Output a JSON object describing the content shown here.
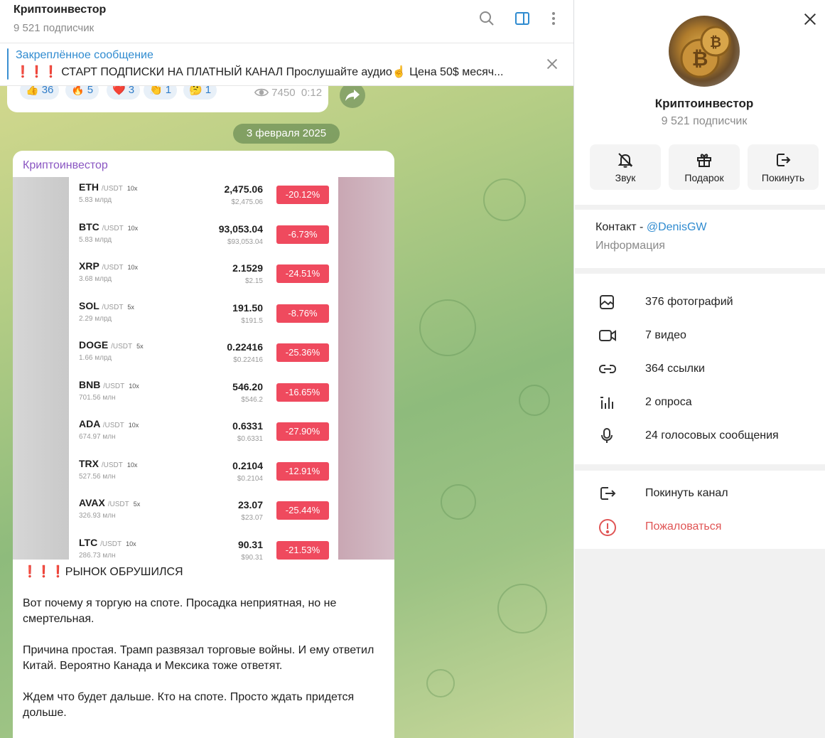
{
  "chat": {
    "title": "Криптоинвестор",
    "subtitle": "9 521 подписчик",
    "icons": [
      "search-icon",
      "panel-toggle-icon",
      "more-vertical-icon"
    ]
  },
  "pinned": {
    "title": "Закреплённое сообщение",
    "text": "❗❗❗ СТАРТ ПОДПИСКИ НА ПЛАТНЫЙ КАНАЛ  Прослушайте аудио☝️  Цена 50$ месяч..."
  },
  "prev_message": {
    "reactions": [
      {
        "emoji": "👍",
        "count": "36"
      },
      {
        "emoji": "🔥",
        "count": "5"
      },
      {
        "emoji": "❤️",
        "count": "3"
      },
      {
        "emoji": "👏",
        "count": "1"
      },
      {
        "emoji": "🤔",
        "count": "1"
      }
    ],
    "views": "7450",
    "duration": "0:12"
  },
  "date_separator": "3 февраля 2025",
  "message": {
    "author": "Криптоинвестор",
    "table": [
      {
        "sym": "ETH",
        "pair": "/USDT",
        "lev": "10x",
        "vol": "5.83 млрд",
        "price": "2,475.06",
        "usd": "$2,475.06",
        "chg": "-20.12%"
      },
      {
        "sym": "BTC",
        "pair": "/USDT",
        "lev": "10x",
        "vol": "5.83 млрд",
        "price": "93,053.04",
        "usd": "$93,053.04",
        "chg": "-6.73%"
      },
      {
        "sym": "XRP",
        "pair": "/USDT",
        "lev": "10x",
        "vol": "3.68 млрд",
        "price": "2.1529",
        "usd": "$2.15",
        "chg": "-24.51%"
      },
      {
        "sym": "SOL",
        "pair": "/USDT",
        "lev": "5x",
        "vol": "2.29 млрд",
        "price": "191.50",
        "usd": "$191.5",
        "chg": "-8.76%"
      },
      {
        "sym": "DOGE",
        "pair": "/USDT",
        "lev": "5x",
        "vol": "1.66 млрд",
        "price": "0.22416",
        "usd": "$0.22416",
        "chg": "-25.36%"
      },
      {
        "sym": "BNB",
        "pair": "/USDT",
        "lev": "10x",
        "vol": "701.56 млн",
        "price": "546.20",
        "usd": "$546.2",
        "chg": "-16.65%"
      },
      {
        "sym": "ADA",
        "pair": "/USDT",
        "lev": "10x",
        "vol": "674.97 млн",
        "price": "0.6331",
        "usd": "$0.6331",
        "chg": "-27.90%"
      },
      {
        "sym": "TRX",
        "pair": "/USDT",
        "lev": "10x",
        "vol": "527.56 млн",
        "price": "0.2104",
        "usd": "$0.2104",
        "chg": "-12.91%"
      },
      {
        "sym": "AVAX",
        "pair": "/USDT",
        "lev": "5x",
        "vol": "326.93 млн",
        "price": "23.07",
        "usd": "$23.07",
        "chg": "-25.44%"
      },
      {
        "sym": "LTC",
        "pair": "/USDT",
        "lev": "10x",
        "vol": "286.73 млн",
        "price": "90.31",
        "usd": "$90.31",
        "chg": "-21.53%"
      }
    ],
    "headline": "❗❗❗РЫНОК ОБРУШИЛСЯ",
    "paragraphs": [
      "Вот почему я торгую на споте. Просадка неприятная, но не смертельная.",
      "Причина простая. Трамп развязал торговые войны. И ему ответил Китай. Вероятно Канада и Мексика тоже ответят.",
      "Ждем что будет дальше. Кто на споте. Просто ждать придется дольше."
    ]
  },
  "profile": {
    "name": "Криптоинвестор",
    "subtitle": "9 521 подписчик",
    "buttons": [
      {
        "label": "Звук",
        "icon": "bell-off-icon"
      },
      {
        "label": "Подарок",
        "icon": "gift-icon"
      },
      {
        "label": "Покинуть",
        "icon": "leave-icon"
      }
    ],
    "contact_prefix": "Контакт - ",
    "contact_link": "@DenisGW",
    "info_label": "Информация",
    "media": [
      {
        "label": "376 фотографий",
        "icon": "photo-icon"
      },
      {
        "label": "7 видео",
        "icon": "video-icon"
      },
      {
        "label": "364 ссылки",
        "icon": "link-icon"
      },
      {
        "label": "2 опроса",
        "icon": "poll-icon"
      },
      {
        "label": "24 голосовых сообщения",
        "icon": "microphone-icon"
      }
    ],
    "leave_channel": "Покинуть канал",
    "report": "Пожаловаться",
    "colors": {
      "accent": "#2f8bd0",
      "danger": "#e05555",
      "change_badge": "#ef4a5e",
      "author": "#8a56c2"
    }
  }
}
